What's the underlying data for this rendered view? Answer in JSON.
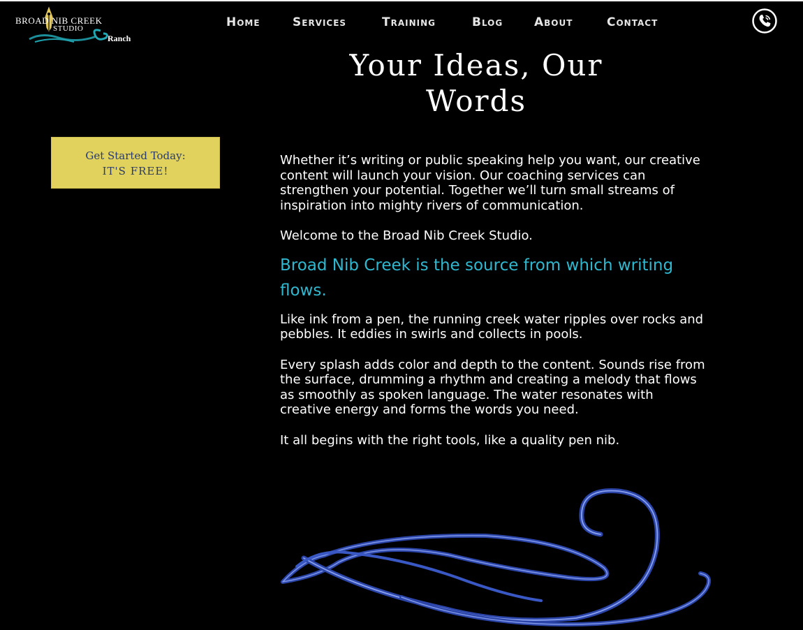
{
  "logo": {
    "line1": "BROAD NIB CREEK",
    "line2": "STUDIO",
    "line3": "Ranch",
    "icon": "pen-nib-icon"
  },
  "nav": {
    "items": [
      {
        "label": "Home"
      },
      {
        "label": "Services"
      },
      {
        "label": "Training"
      },
      {
        "label": "Blog"
      },
      {
        "label": "About"
      },
      {
        "label": "Contact"
      }
    ],
    "phone_icon": "phone-icon"
  },
  "hero": {
    "line1": "Your Ideas, Our",
    "line2": "Words"
  },
  "cta": {
    "line1": "Get Started Today:",
    "line2": "IT'S FREE!"
  },
  "content": {
    "intro": "Whether it’s writing or public speaking help you want, our creative content will launch your vision. Our coaching services can strengthen your potential. Together we’ll turn small streams of inspiration into mighty rivers of communication.",
    "welcome": "Welcome to the Broad Nib Creek Studio.",
    "tagline": "Broad Nib Creek is the source from which writing flows.",
    "para1": "Like ink from a pen, the running creek water ripples over rocks and pebbles. It eddies in swirls and collects in pools.",
    "para2": "Every splash adds color and depth to the content. Sounds rise from the surface, drumming a rhythm and creating a melody that flows as smoothly as spoken language. The water resonates with creative energy and forms the words you need.",
    "para3": "It all begins with the right tools, like a quality pen nib."
  },
  "colors": {
    "background": "#000000",
    "accent": "#2fb8cf",
    "cta_bg": "#e1d25e",
    "cta_text": "#2a3a6a",
    "swirl": "#3550b8"
  }
}
